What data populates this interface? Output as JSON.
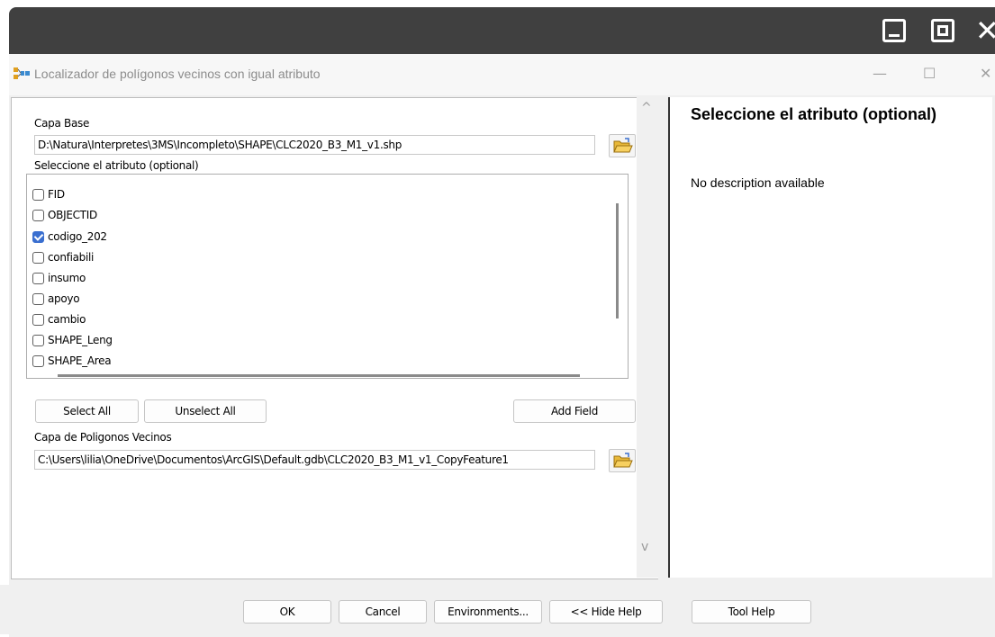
{
  "outer_controls": {
    "close_glyph": "✕"
  },
  "window": {
    "title": "Localizador de polígonos vecinos con igual atributo",
    "min_glyph": "—",
    "max_glyph": "☐",
    "close_glyph": "✕"
  },
  "form": {
    "capa_base_label": "Capa Base",
    "capa_base_value": "D:\\Natura\\Interpretes\\3MS\\Incompleto\\SHAPE\\CLC2020_B3_M1_v1.shp",
    "atributo_label": "Seleccione el atributo  (optional)",
    "fields": [
      {
        "label": "FID",
        "checked": false
      },
      {
        "label": "OBJECTID",
        "checked": false
      },
      {
        "label": "codigo_202",
        "checked": true
      },
      {
        "label": "confiabili",
        "checked": false
      },
      {
        "label": "insumo",
        "checked": false
      },
      {
        "label": "apoyo",
        "checked": false
      },
      {
        "label": "cambio",
        "checked": false
      },
      {
        "label": "SHAPE_Leng",
        "checked": false
      },
      {
        "label": "SHAPE_Area",
        "checked": false
      }
    ],
    "select_all": "Select All",
    "unselect_all": "Unselect All",
    "add_field": "Add Field",
    "vecinos_label": "Capa de Poligonos Vecinos",
    "vecinos_value": "C:\\Users\\lilia\\OneDrive\\Documentos\\ArcGIS\\Default.gdb\\CLC2020_B3_M1_v1_CopyFeature1"
  },
  "help": {
    "title": "Seleccione el atributo (optional)",
    "description": "No description available"
  },
  "buttons": {
    "ok": "OK",
    "cancel": "Cancel",
    "environments": "Environments...",
    "hide_help": "<< Hide Help",
    "tool_help": "Tool Help"
  },
  "scroll": {
    "up": "^",
    "down": "v"
  },
  "colors": {
    "check_accent": "#3a6fd0",
    "outer_bar": "#404040"
  }
}
